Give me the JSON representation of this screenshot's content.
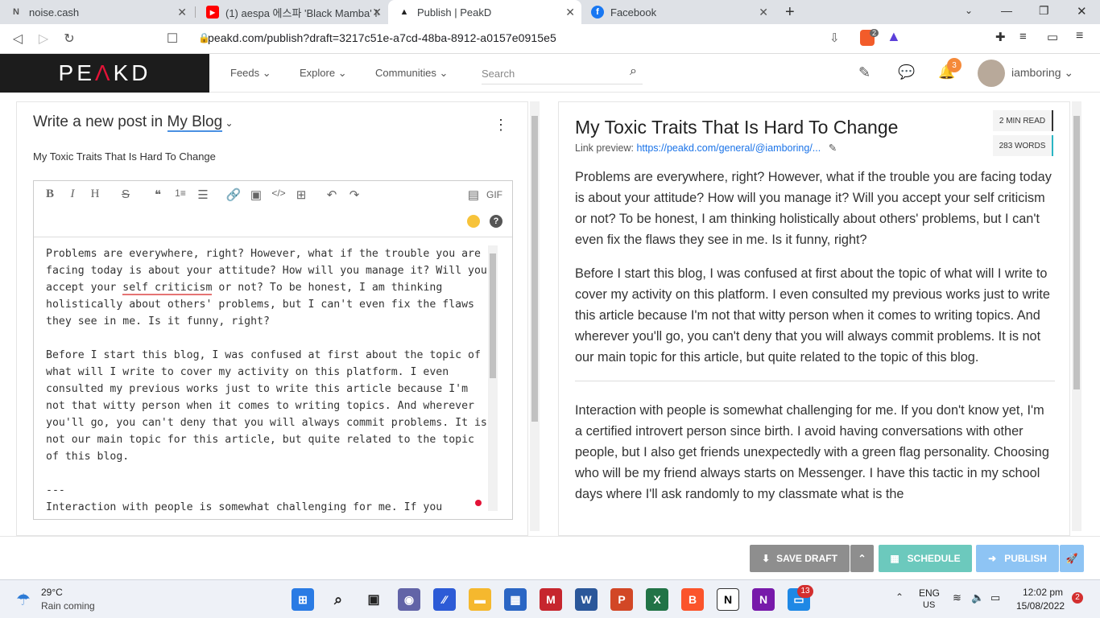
{
  "browser": {
    "tabs": [
      {
        "title": "noise.cash",
        "icon": "N"
      },
      {
        "title": "(1) aespa 에스파 'Black Mamba' M",
        "icon": "▶"
      },
      {
        "title": "Publish | PeakD",
        "icon": "▲"
      },
      {
        "title": "Facebook",
        "icon": "f"
      }
    ],
    "url": "peakd.com/publish?draft=3217c51e-a7cd-48ba-8912-a0157e0915e5",
    "new_tab": "+",
    "brave_count": "2"
  },
  "site": {
    "logo_left": "PE",
    "logo_mid": "Λ",
    "logo_right": "KD",
    "nav": [
      "Feeds",
      "Explore",
      "Communities"
    ],
    "search_placeholder": "Search",
    "notif_count": "3",
    "username": "iamboring",
    "accent": "#e31337"
  },
  "editor": {
    "header_prefix": "Write a new post in",
    "blog_name": "My Blog",
    "post_title": "My Toxic Traits That Is Hard To Change",
    "gif_label": "GIF",
    "para1_before": "Problems are everywhere, right? However, what if the trouble you are facing today is about your attitude? How will you manage it? Will you accept your ",
    "para1_spell": "self criticism",
    "para1_after": " or not? To be honest, I am thinking holistically about others' problems, but I can't even fix the flaws they see in me. Is it funny, right?",
    "para2": "Before I start this blog, I was confused at first about the topic of what will I write to cover my activity on this platform. I even consulted my previous works just to write this article because I'm not that witty person when it comes to writing topics. And wherever you'll go, you can't deny that you will always commit problems. It is not our main topic for this article, but quite related to the topic of this blog.",
    "separator": "---",
    "para3": "Interaction with people is somewhat challenging for me. If you"
  },
  "preview": {
    "title": "My Toxic Traits That Is Hard To Change",
    "link_label": "Link preview:",
    "link": "https://peakd.com/general/@iamboring/...",
    "read_time": "2 MIN READ",
    "words": "283 WORDS",
    "paragraphs": [
      "Problems are everywhere, right? However, what if the trouble you are facing today is about your attitude? How will you manage it? Will you accept your self criticism or not? To be honest, I am thinking holistically about others' problems, but I can't even fix the flaws they see in me. Is it funny, right?",
      "Before I start this blog, I was confused at first about the topic of what will I write to cover my activity on this platform. I even consulted my previous works just to write this article because I'm not that witty person when it comes to writing topics. And wherever you'll go, you can't deny that you will always commit problems. It is not our main topic for this article, but quite related to the topic of this blog.",
      "Interaction with people is somewhat challenging for me. If you don't know yet, I'm a certified introvert person since birth. I avoid having conversations with other people, but I also get friends unexpectedly with a green flag personality. Choosing who will be my friend always starts on Messenger. I have this tactic in my school days where I'll ask randomly to my classmate what is the"
    ]
  },
  "actions": {
    "save_draft": "SAVE DRAFT",
    "schedule": "SCHEDULE",
    "publish": "PUBLISH"
  },
  "taskbar": {
    "temp": "29°C",
    "weather": "Rain coming",
    "lang": "ENG",
    "region": "US",
    "time": "12:02 pm",
    "date": "15/08/2022",
    "notif": "2",
    "store_badge": "13"
  }
}
